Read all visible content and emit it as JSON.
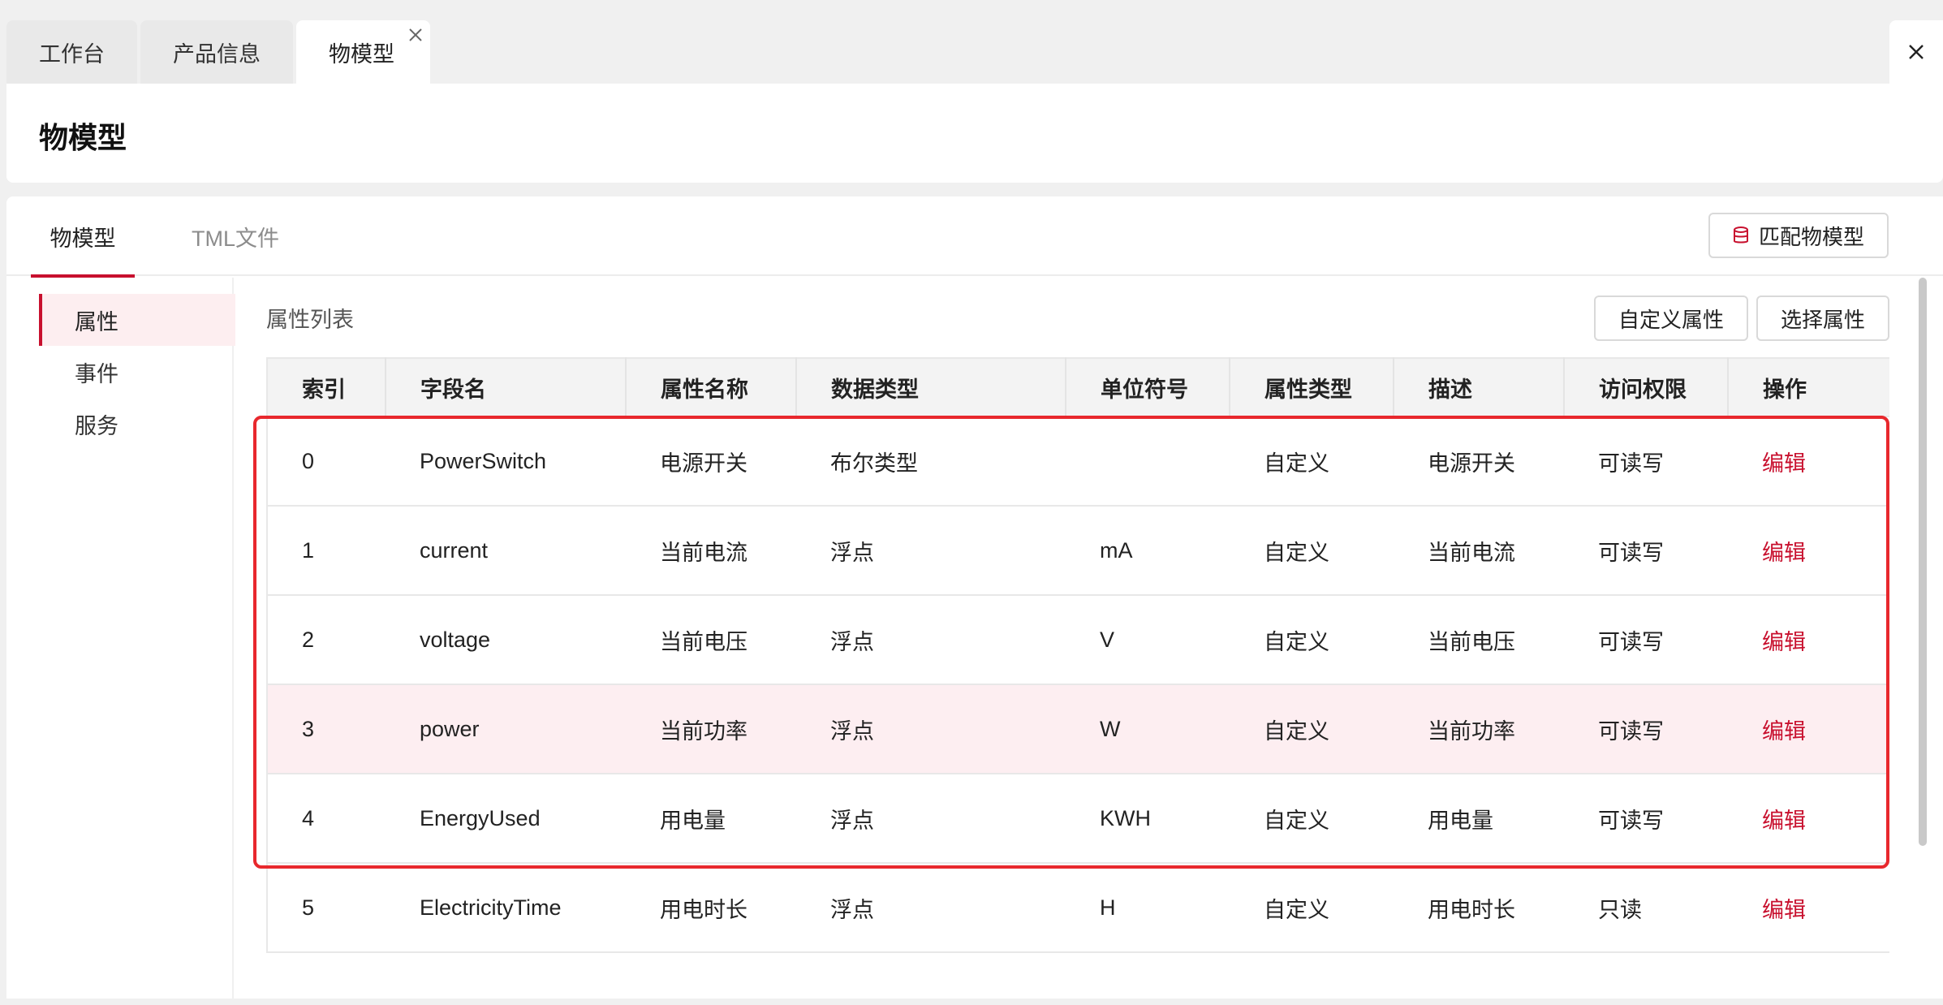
{
  "top_tabs": [
    {
      "label": "工作台"
    },
    {
      "label": "产品信息"
    },
    {
      "label": "物模型"
    }
  ],
  "header": {
    "title": "物模型"
  },
  "main_tabs": [
    {
      "label": "物模型"
    },
    {
      "label": "TML文件"
    }
  ],
  "buttons": {
    "match_label": "匹配物模型",
    "custom_label": "自定义属性",
    "choose_label": "选择属性"
  },
  "side_menu": [
    {
      "label": "属性"
    },
    {
      "label": "事件"
    },
    {
      "label": "服务"
    }
  ],
  "list_title": "属性列表",
  "table": {
    "columns": [
      "索引",
      "字段名",
      "属性名称",
      "数据类型",
      "单位符号",
      "属性类型",
      "描述",
      "访问权限",
      "操作"
    ],
    "rows": [
      [
        "0",
        "PowerSwitch",
        "电源开关",
        "布尔类型",
        "",
        "自定义",
        "电源开关",
        "可读写",
        "编辑"
      ],
      [
        "1",
        "current",
        "当前电流",
        "浮点",
        "mA",
        "自定义",
        "当前电流",
        "可读写",
        "编辑"
      ],
      [
        "2",
        "voltage",
        "当前电压",
        "浮点",
        "V",
        "自定义",
        "当前电压",
        "可读写",
        "编辑"
      ],
      [
        "3",
        "power",
        "当前功率",
        "浮点",
        "W",
        "自定义",
        "当前功率",
        "可读写",
        "编辑"
      ],
      [
        "4",
        "EnergyUsed",
        "用电量",
        "浮点",
        "KWH",
        "自定义",
        "用电量",
        "可读写",
        "编辑"
      ],
      [
        "5",
        "ElectricityTime",
        "用电时长",
        "浮点",
        "H",
        "自定义",
        "用电时长",
        "只读",
        "编辑"
      ]
    ],
    "highlighted_row": 3
  },
  "colors": {
    "accent": "#c8102e",
    "row_highlight": "#fdeef1",
    "annotation": "#e8282d"
  },
  "icons": {
    "tab_close": "close-icon",
    "window_close": "close-icon",
    "match_button": "database-icon"
  }
}
